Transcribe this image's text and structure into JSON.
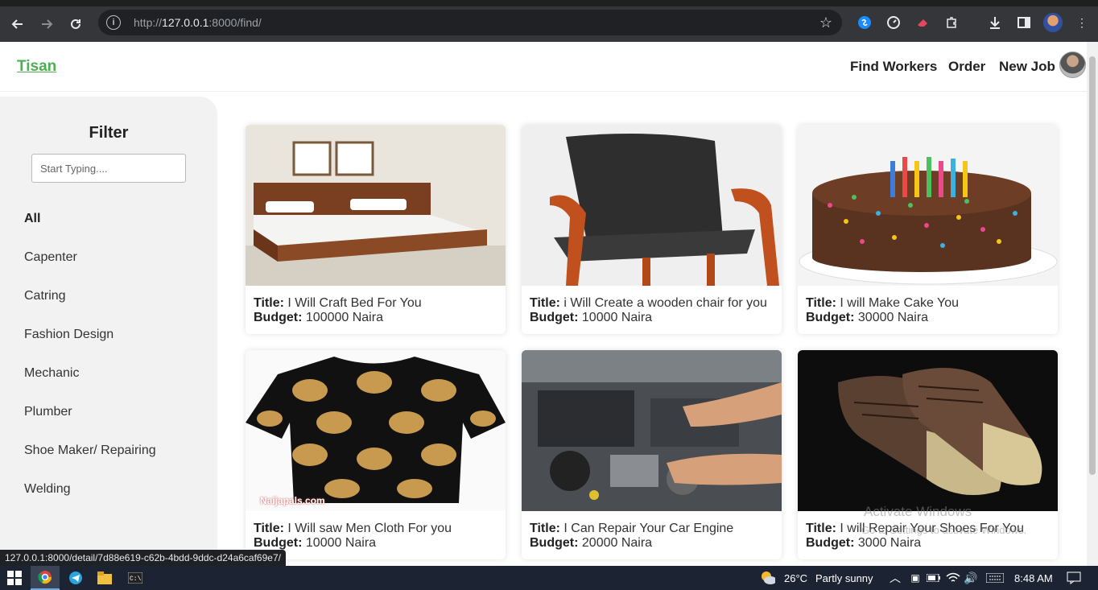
{
  "browser": {
    "url_prefix": "http://",
    "url_host": "127.0.0.1",
    "url_path": ":8000/find/",
    "back_icon": "back-arrow-icon",
    "status_url": "127.0.0.1:8000/detail/7d88e619-c62b-4bdd-9ddc-d24a6caf69e7/"
  },
  "header": {
    "brand": "Tisan",
    "nav": [
      "Find Workers",
      "Order",
      "New Job"
    ]
  },
  "sidebar": {
    "title": "Filter",
    "search_placeholder": "Start Typing....",
    "categories": [
      "All",
      "Capenter",
      "Catring",
      "Fashion Design",
      "Mechanic",
      "Plumber",
      "Shoe Maker/ Repairing",
      "Welding"
    ]
  },
  "cards": [
    {
      "title_label": "Title:",
      "title": "I Will Craft Bed For You",
      "budget_label": "Budget:",
      "budget": "100000 Naira",
      "image": "bed"
    },
    {
      "title_label": "Title:",
      "title": "i Will Create a wooden chair for you",
      "budget_label": "Budget:",
      "budget": "10000 Naira",
      "image": "chair"
    },
    {
      "title_label": "Title:",
      "title": "I will Make Cake You",
      "budget_label": "Budget:",
      "budget": "30000 Naira",
      "image": "cake"
    },
    {
      "title_label": "Title:",
      "title": "I Will saw Men Cloth For you",
      "budget_label": "Budget:",
      "budget": "10000 Naira",
      "image": "shirt",
      "image_caption": "Naijapals.com"
    },
    {
      "title_label": "Title:",
      "title": "I Can Repair Your Car Engine",
      "budget_label": "Budget:",
      "budget": "20000 Naira",
      "image": "engine"
    },
    {
      "title_label": "Title:",
      "title": "I will Repair Your Shoes For You",
      "budget_label": "Budget:",
      "budget": "3000 Naira",
      "image": "shoes"
    }
  ],
  "watermark": {
    "line1": "Activate Windows",
    "line2": "Go to Settings to activate Windows."
  },
  "taskbar": {
    "temperature": "26°C",
    "weather": "Partly sunny",
    "time": "8:48 AM"
  },
  "colors": {
    "brand": "#4caf50",
    "chrome": "#35363a",
    "sidebar_bg": "#f2f2f2",
    "taskbar": "#1c2433"
  }
}
